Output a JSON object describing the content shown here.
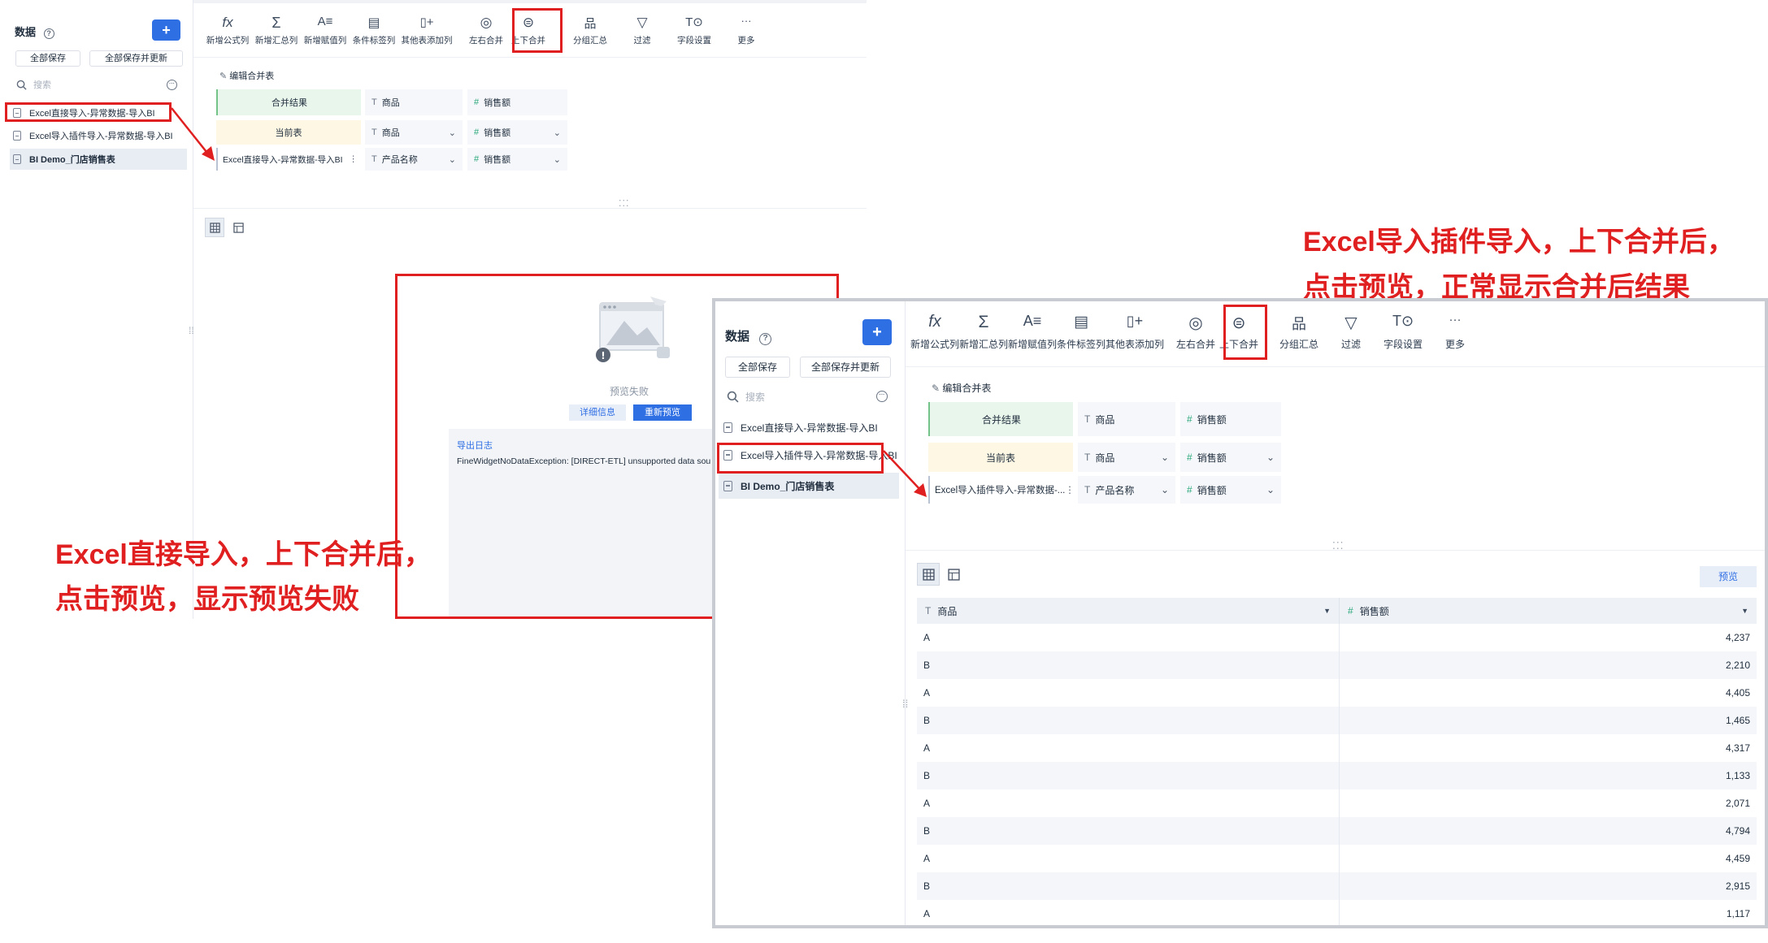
{
  "sidebar": {
    "title": "数据",
    "help_glyph": "?",
    "add_label": "+",
    "save_all": "全部保存",
    "save_all_update": "全部保存并更新",
    "search_placeholder": "搜索",
    "more_glyph": "···",
    "items": [
      {
        "label": "Excel直接导入-异常数据-导入BI"
      },
      {
        "label": "Excel导入插件导入-异常数据-导入BI"
      },
      {
        "label": "BI Demo_门店销售表"
      }
    ]
  },
  "toolbar": {
    "items": [
      {
        "icon": "fx",
        "label": "新增公式列"
      },
      {
        "icon": "Σ",
        "label": "新增汇总列"
      },
      {
        "icon": "A≡",
        "label": "新增赋值列"
      },
      {
        "icon": "▤",
        "label": "条件标签列"
      },
      {
        "icon": "▯+",
        "label": "其他表添加列"
      },
      {
        "icon": "◎",
        "label": "左右合并"
      },
      {
        "icon": "⊜",
        "label": "上下合并"
      },
      {
        "icon": "品",
        "label": "分组汇总"
      },
      {
        "icon": "▽",
        "label": "过滤"
      },
      {
        "icon": "T⊙",
        "label": "字段设置"
      },
      {
        "icon": "···",
        "label": "更多"
      }
    ]
  },
  "merge_editor": {
    "title": "编辑合并表",
    "result_label": "合并结果",
    "current_label": "当前表",
    "result_fields": [
      "商品",
      "销售额"
    ],
    "current_fields": [
      "商品",
      "销售额"
    ],
    "type_text": "T",
    "type_num": "#",
    "chevron": "⌄",
    "kebab": "⋮"
  },
  "left": {
    "other_table": "Excel直接导入-异常数据-导入BI",
    "other_fields": [
      "产品名称",
      "销售额"
    ],
    "fail_text": "预览失败",
    "detail_btn": "详细信息",
    "retry_btn": "重新预览",
    "log_title": "导出日志",
    "log_text": "FineWidgetNoDataException: [DIRECT-ETL] unsupported data sou",
    "annotation_line1": "Excel直接导入，上下合并后，",
    "annotation_line2": "点击预览，显示预览失败"
  },
  "right": {
    "other_table": "Excel导入插件导入-异常数据-...",
    "other_fields": [
      "产品名称",
      "销售额"
    ],
    "preview_btn": "预览",
    "annotation_line1": "Excel导入插件导入，上下合并后，",
    "annotation_line2": "点击预览，正常显示合并后结果",
    "table": {
      "columns": [
        "商品",
        "销售额"
      ],
      "sort_glyph": "▼",
      "rows": [
        [
          "A",
          "4,237"
        ],
        [
          "B",
          "2,210"
        ],
        [
          "A",
          "4,405"
        ],
        [
          "B",
          "1,465"
        ],
        [
          "A",
          "4,317"
        ],
        [
          "B",
          "1,133"
        ],
        [
          "A",
          "2,071"
        ],
        [
          "B",
          "4,794"
        ],
        [
          "A",
          "4,459"
        ],
        [
          "B",
          "2,915"
        ],
        [
          "A",
          "1,117"
        ]
      ]
    }
  }
}
